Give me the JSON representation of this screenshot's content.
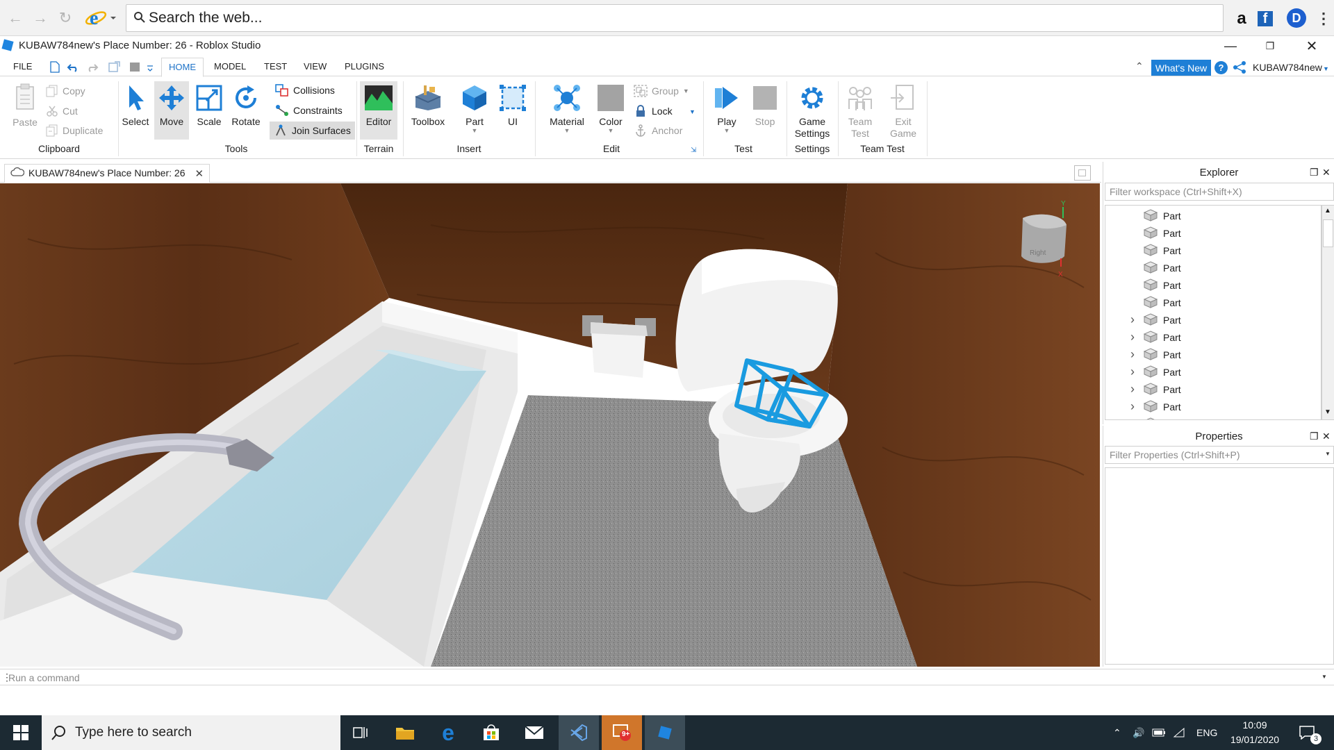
{
  "browser": {
    "search_placeholder": "Search the web...",
    "ext_amazon": "a",
    "ext_facebook": "f",
    "ext_dash": "D"
  },
  "studio": {
    "title": "KUBAW784new's Place Number: 26 - Roblox Studio"
  },
  "menu": {
    "tabs": [
      "FILE",
      "HOME",
      "MODEL",
      "TEST",
      "VIEW",
      "PLUGINS"
    ],
    "active_tab": "HOME",
    "whats_new": "What's New",
    "help": "?",
    "user": "KUBAW784new"
  },
  "ribbon": {
    "clipboard": {
      "paste": "Paste",
      "copy": "Copy",
      "cut": "Cut",
      "duplicate": "Duplicate",
      "label": "Clipboard"
    },
    "tools": {
      "select": "Select",
      "move": "Move",
      "scale": "Scale",
      "rotate": "Rotate",
      "collisions": "Collisions",
      "constraints": "Constraints",
      "join_surfaces": "Join Surfaces",
      "label": "Tools"
    },
    "terrain": {
      "editor": "Editor",
      "label": "Terrain"
    },
    "insert": {
      "toolbox": "Toolbox",
      "part": "Part",
      "ui": "UI",
      "label": "Insert"
    },
    "edit": {
      "material": "Material",
      "color": "Color",
      "group": "Group",
      "lock": "Lock",
      "anchor": "Anchor",
      "label": "Edit"
    },
    "test": {
      "play": "Play",
      "stop": "Stop",
      "label": "Test"
    },
    "settings": {
      "game_settings_1": "Game",
      "game_settings_2": "Settings",
      "label": "Settings"
    },
    "team_test": {
      "team_test_1": "Team",
      "team_test_2": "Test",
      "exit_game_1": "Exit",
      "exit_game_2": "Game",
      "label": "Team Test"
    }
  },
  "document": {
    "tab_title": "KUBAW784new's Place Number: 26"
  },
  "viewport": {
    "view_cube_face": "Right",
    "axis_y": "Y",
    "axis_x": "X"
  },
  "explorer": {
    "title": "Explorer",
    "filter_placeholder": "Filter workspace (Ctrl+Shift+X)",
    "items": [
      {
        "label": "Part",
        "expandable": false
      },
      {
        "label": "Part",
        "expandable": false
      },
      {
        "label": "Part",
        "expandable": false
      },
      {
        "label": "Part",
        "expandable": false
      },
      {
        "label": "Part",
        "expandable": false
      },
      {
        "label": "Part",
        "expandable": false
      },
      {
        "label": "Part",
        "expandable": true
      },
      {
        "label": "Part",
        "expandable": true
      },
      {
        "label": "Part",
        "expandable": true
      },
      {
        "label": "Part",
        "expandable": true
      },
      {
        "label": "Part",
        "expandable": true
      },
      {
        "label": "Part",
        "expandable": true
      },
      {
        "label": "Part",
        "expandable": false
      }
    ]
  },
  "properties": {
    "title": "Properties",
    "filter_placeholder": "Filter Properties (Ctrl+Shift+P)"
  },
  "command": {
    "placeholder": "Run a command"
  },
  "taskbar": {
    "search_placeholder": "Type here to search",
    "language": "ENG",
    "time": "10:09",
    "date": "19/01/2020",
    "notifications": "3",
    "badge": "9+"
  },
  "colors": {
    "accent": "#1e7fd6",
    "selection": "#1a9be0",
    "wood": "#5a2f16",
    "taskbar": "#1c2a33"
  }
}
